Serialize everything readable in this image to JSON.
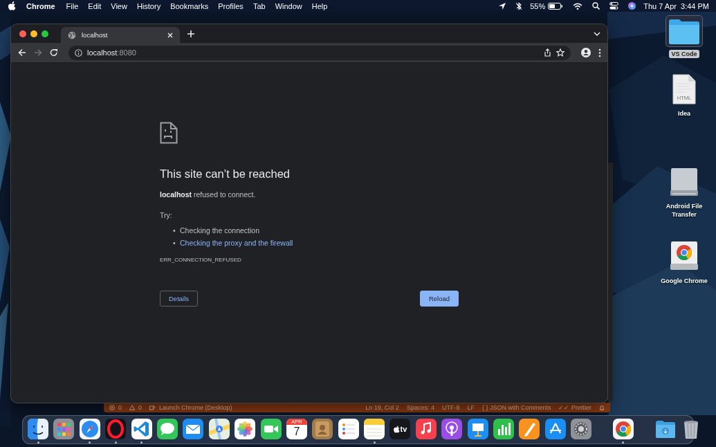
{
  "menu_bar": {
    "app": "Chrome",
    "menus": [
      "File",
      "Edit",
      "View",
      "History",
      "Bookmarks",
      "Profiles",
      "Tab",
      "Window",
      "Help"
    ],
    "battery": "55%",
    "clock": "Thu 7 Apr  3:44 PM"
  },
  "browser": {
    "tabs": [
      {
        "title": "localhost",
        "selected": true
      }
    ],
    "address": {
      "host": "localhost",
      "port": ":8080"
    },
    "error_page": {
      "heading": "This site can’t be reached",
      "message": "**localhost** refused to connect.",
      "try_label": "Try:",
      "suggestions": [
        {
          "marker": "•",
          "text": "Checking the connection",
          "kind": "text"
        },
        {
          "marker": "•",
          "text": "Checking the proxy and the firewall",
          "kind": "link"
        }
      ],
      "code": "ERR_CONNECTION_REFUSED",
      "buttons": [
        {
          "label": "Details",
          "kind": "secondary"
        },
        {
          "label": "Reload",
          "kind": "primary"
        }
      ]
    }
  },
  "editor_status_bar": {
    "items": [
      {
        "text": "0",
        "kind": "error"
      },
      {
        "text": "0",
        "kind": "warning"
      },
      {
        "text": "Launch Chrome (Desktop)",
        "kind": "debug"
      },
      {
        "text": "Ln 19, Col 2",
        "kind": "right"
      },
      {
        "text": "Spaces: 4",
        "kind": "right"
      },
      {
        "text": "UTF-8",
        "kind": "right"
      },
      {
        "text": "LF",
        "kind": "right"
      },
      {
        "text": "{ } JSON with Comments",
        "kind": "right"
      },
      {
        "text": "✓✓ Prettier",
        "kind": "right"
      }
    ]
  },
  "desktop_icons": [
    {
      "label": "VS Code",
      "kind": "folder",
      "selected": true
    },
    {
      "label": "Idea",
      "kind": "html",
      "badge": "HTML",
      "selected": false
    },
    {
      "label": "Android File Transfer",
      "kind": "drive",
      "selected": false
    },
    {
      "label": "Google Chrome",
      "kind": "chrome",
      "selected": false
    }
  ],
  "dock": {
    "apps": [
      {
        "kind": "finder",
        "running": true
      },
      {
        "kind": "launchpad",
        "running": false
      },
      {
        "kind": "safari",
        "running": true
      },
      {
        "kind": "opera",
        "running": true
      },
      {
        "kind": "vscode",
        "running": true
      },
      {
        "kind": "messages",
        "running": false
      },
      {
        "kind": "mail",
        "running": false
      },
      {
        "kind": "maps",
        "running": false
      },
      {
        "kind": "photos",
        "running": false
      },
      {
        "kind": "facetime",
        "running": false
      },
      {
        "kind": "calendar",
        "month": "APR",
        "day": "7",
        "running": false
      },
      {
        "kind": "contacts",
        "running": false
      },
      {
        "kind": "reminders",
        "running": false
      },
      {
        "kind": "notes",
        "running": true
      },
      {
        "kind": "tv",
        "label": "tv",
        "running": false
      },
      {
        "kind": "music",
        "running": false
      },
      {
        "kind": "podcasts",
        "running": false
      },
      {
        "kind": "keynote",
        "running": false
      },
      {
        "kind": "numbers",
        "running": false
      },
      {
        "kind": "pages",
        "running": false
      },
      {
        "kind": "appstore",
        "running": false
      },
      {
        "kind": "settings",
        "running": false
      },
      {
        "kind": "separator"
      },
      {
        "kind": "chrome",
        "running": true
      },
      {
        "kind": "separator"
      },
      {
        "kind": "downloads",
        "running": false
      },
      {
        "kind": "trash",
        "running": false
      }
    ]
  }
}
